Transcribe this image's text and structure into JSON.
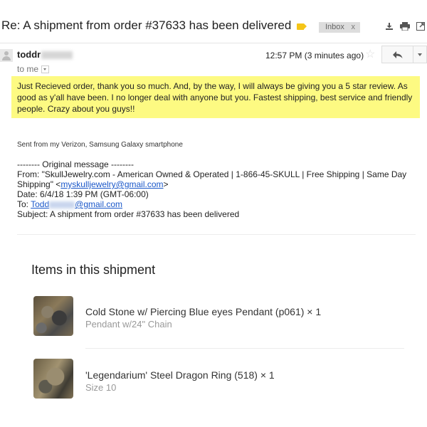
{
  "header": {
    "subject": "Re: A shipment from order #37633 has been delivered",
    "label": "Inbox",
    "label_close": "x",
    "icons": [
      "download-icon",
      "print-icon",
      "new-window-icon"
    ]
  },
  "message": {
    "sender_name": "toddr",
    "recipient": "to me",
    "time": "12:57 PM (3 minutes ago)",
    "body": "Just Recieved order, thank you so much.  And, by the way, I will always be giving you a 5 star review.  As good as y'all have been. I no longer deal with anyone but you.  Fastest shipping, best service and friendly people.  Crazy about you guys!!",
    "signature": "Sent from my Verizon, Samsung Galaxy smartphone"
  },
  "original": {
    "divider": "-------- Original message --------",
    "from_label": "From: \"SkullJewelry.com - American Owned & Operated | 1-866-45-SKULL | Free Shipping | Same Day",
    "from_cont_prefix": "Shipping\" <",
    "from_email": "myskulljewelry@gmail.com",
    "from_cont_suffix": ">",
    "date": "Date: 6/4/18 1:39 PM (GMT-06:00)",
    "to_label": "To: ",
    "to_name": "Todd",
    "to_domain": "@gmail.com",
    "subject": "Subject: A shipment from order #37633 has been delivered"
  },
  "shipment": {
    "title": "Items in this shipment",
    "items": [
      {
        "name": "Cold Stone w/ Piercing Blue eyes Pendant (p061) × 1",
        "detail": "Pendant w/24\" Chain"
      },
      {
        "name": "'Legendarium' Steel Dragon Ring (518) × 1",
        "detail": "Size 10"
      }
    ]
  }
}
